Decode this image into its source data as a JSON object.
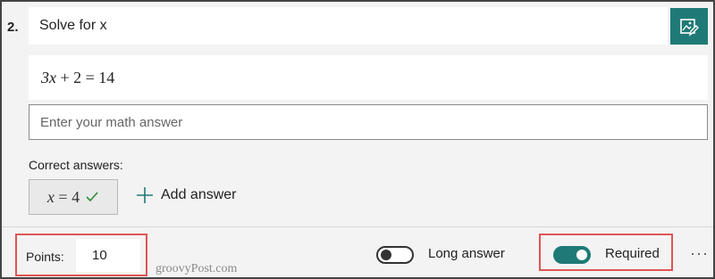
{
  "question": {
    "number": "2.",
    "title": "Solve for x",
    "equation": {
      "left_var": "3x",
      "rest": " + 2 = 14"
    }
  },
  "answer_input": {
    "placeholder": "Enter your math answer",
    "value": ""
  },
  "correct_answers": {
    "label": "Correct answers:",
    "items": [
      {
        "var": "x",
        "rest": " = 4"
      }
    ],
    "add_label": "Add answer"
  },
  "footer": {
    "points_label": "Points:",
    "points_value": "10",
    "long_answer_label": "Long answer",
    "long_answer_on": false,
    "required_label": "Required",
    "required_on": true,
    "more_label": "···"
  },
  "watermark": "groovyPost.com",
  "colors": {
    "accent": "#1f7a76",
    "highlight": "#e05555",
    "check": "#2e8b3d"
  },
  "icons": {
    "edit": "image-edit-icon",
    "check": "check-icon",
    "add": "plus-icon",
    "more": "more-icon"
  }
}
